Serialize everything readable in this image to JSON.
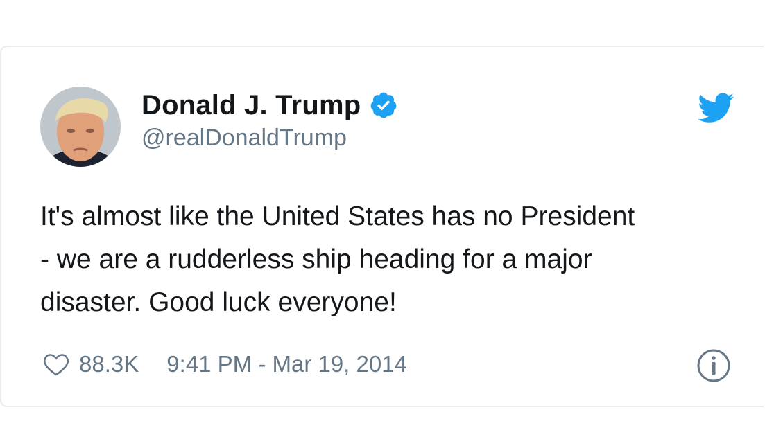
{
  "author": {
    "display_name": "Donald J. Trump",
    "handle": "@realDonaldTrump",
    "verified": true,
    "avatar_icon": "profile-photo"
  },
  "tweet": {
    "text_lines": [
      "It's almost like the United States has no President",
      "- we are a rudderless ship heading for a major",
      "disaster. Good luck everyone!"
    ]
  },
  "footer": {
    "like_count": "88.3K",
    "timestamp": "9:41 PM - Mar 19, 2014"
  },
  "icons": {
    "verified": "verified-badge-icon",
    "brand": "twitter-bird-icon",
    "like": "heart-icon",
    "info": "info-icon"
  },
  "colors": {
    "brand_blue": "#1da1f2",
    "text_primary": "#14171a",
    "text_secondary": "#657786",
    "border": "#e6ecf0"
  }
}
